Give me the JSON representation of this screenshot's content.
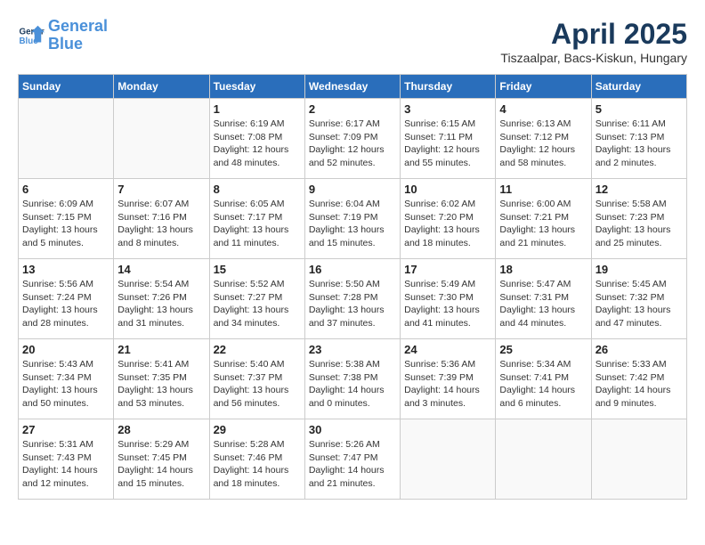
{
  "logo": {
    "line1": "General",
    "line2": "Blue"
  },
  "title": "April 2025",
  "subtitle": "Tiszaalpar, Bacs-Kiskun, Hungary",
  "days_of_week": [
    "Sunday",
    "Monday",
    "Tuesday",
    "Wednesday",
    "Thursday",
    "Friday",
    "Saturday"
  ],
  "weeks": [
    [
      {
        "day": "",
        "info": ""
      },
      {
        "day": "",
        "info": ""
      },
      {
        "day": "1",
        "info": "Sunrise: 6:19 AM\nSunset: 7:08 PM\nDaylight: 12 hours\nand 48 minutes."
      },
      {
        "day": "2",
        "info": "Sunrise: 6:17 AM\nSunset: 7:09 PM\nDaylight: 12 hours\nand 52 minutes."
      },
      {
        "day": "3",
        "info": "Sunrise: 6:15 AM\nSunset: 7:11 PM\nDaylight: 12 hours\nand 55 minutes."
      },
      {
        "day": "4",
        "info": "Sunrise: 6:13 AM\nSunset: 7:12 PM\nDaylight: 12 hours\nand 58 minutes."
      },
      {
        "day": "5",
        "info": "Sunrise: 6:11 AM\nSunset: 7:13 PM\nDaylight: 13 hours\nand 2 minutes."
      }
    ],
    [
      {
        "day": "6",
        "info": "Sunrise: 6:09 AM\nSunset: 7:15 PM\nDaylight: 13 hours\nand 5 minutes."
      },
      {
        "day": "7",
        "info": "Sunrise: 6:07 AM\nSunset: 7:16 PM\nDaylight: 13 hours\nand 8 minutes."
      },
      {
        "day": "8",
        "info": "Sunrise: 6:05 AM\nSunset: 7:17 PM\nDaylight: 13 hours\nand 11 minutes."
      },
      {
        "day": "9",
        "info": "Sunrise: 6:04 AM\nSunset: 7:19 PM\nDaylight: 13 hours\nand 15 minutes."
      },
      {
        "day": "10",
        "info": "Sunrise: 6:02 AM\nSunset: 7:20 PM\nDaylight: 13 hours\nand 18 minutes."
      },
      {
        "day": "11",
        "info": "Sunrise: 6:00 AM\nSunset: 7:21 PM\nDaylight: 13 hours\nand 21 minutes."
      },
      {
        "day": "12",
        "info": "Sunrise: 5:58 AM\nSunset: 7:23 PM\nDaylight: 13 hours\nand 25 minutes."
      }
    ],
    [
      {
        "day": "13",
        "info": "Sunrise: 5:56 AM\nSunset: 7:24 PM\nDaylight: 13 hours\nand 28 minutes."
      },
      {
        "day": "14",
        "info": "Sunrise: 5:54 AM\nSunset: 7:26 PM\nDaylight: 13 hours\nand 31 minutes."
      },
      {
        "day": "15",
        "info": "Sunrise: 5:52 AM\nSunset: 7:27 PM\nDaylight: 13 hours\nand 34 minutes."
      },
      {
        "day": "16",
        "info": "Sunrise: 5:50 AM\nSunset: 7:28 PM\nDaylight: 13 hours\nand 37 minutes."
      },
      {
        "day": "17",
        "info": "Sunrise: 5:49 AM\nSunset: 7:30 PM\nDaylight: 13 hours\nand 41 minutes."
      },
      {
        "day": "18",
        "info": "Sunrise: 5:47 AM\nSunset: 7:31 PM\nDaylight: 13 hours\nand 44 minutes."
      },
      {
        "day": "19",
        "info": "Sunrise: 5:45 AM\nSunset: 7:32 PM\nDaylight: 13 hours\nand 47 minutes."
      }
    ],
    [
      {
        "day": "20",
        "info": "Sunrise: 5:43 AM\nSunset: 7:34 PM\nDaylight: 13 hours\nand 50 minutes."
      },
      {
        "day": "21",
        "info": "Sunrise: 5:41 AM\nSunset: 7:35 PM\nDaylight: 13 hours\nand 53 minutes."
      },
      {
        "day": "22",
        "info": "Sunrise: 5:40 AM\nSunset: 7:37 PM\nDaylight: 13 hours\nand 56 minutes."
      },
      {
        "day": "23",
        "info": "Sunrise: 5:38 AM\nSunset: 7:38 PM\nDaylight: 14 hours\nand 0 minutes."
      },
      {
        "day": "24",
        "info": "Sunrise: 5:36 AM\nSunset: 7:39 PM\nDaylight: 14 hours\nand 3 minutes."
      },
      {
        "day": "25",
        "info": "Sunrise: 5:34 AM\nSunset: 7:41 PM\nDaylight: 14 hours\nand 6 minutes."
      },
      {
        "day": "26",
        "info": "Sunrise: 5:33 AM\nSunset: 7:42 PM\nDaylight: 14 hours\nand 9 minutes."
      }
    ],
    [
      {
        "day": "27",
        "info": "Sunrise: 5:31 AM\nSunset: 7:43 PM\nDaylight: 14 hours\nand 12 minutes."
      },
      {
        "day": "28",
        "info": "Sunrise: 5:29 AM\nSunset: 7:45 PM\nDaylight: 14 hours\nand 15 minutes."
      },
      {
        "day": "29",
        "info": "Sunrise: 5:28 AM\nSunset: 7:46 PM\nDaylight: 14 hours\nand 18 minutes."
      },
      {
        "day": "30",
        "info": "Sunrise: 5:26 AM\nSunset: 7:47 PM\nDaylight: 14 hours\nand 21 minutes."
      },
      {
        "day": "",
        "info": ""
      },
      {
        "day": "",
        "info": ""
      },
      {
        "day": "",
        "info": ""
      }
    ]
  ]
}
